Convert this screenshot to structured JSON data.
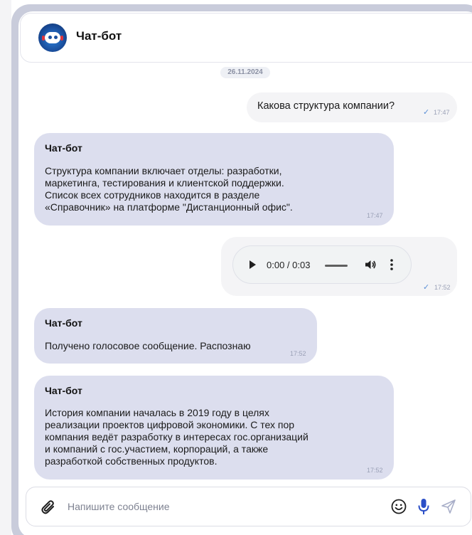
{
  "header": {
    "title": "Чат-бот",
    "avatar_icon": "robot-avatar-icon"
  },
  "date_separator": "26.11.2024",
  "messages": [
    {
      "type": "outgoing",
      "text": "Какова структура компании?",
      "time": "17:47",
      "status_icon": "check-icon"
    },
    {
      "type": "incoming",
      "sender": "Чат-бот",
      "lines": [
        "Структура компании включает отделы: разработки,",
        "маркетинга, тестирования и клиентской поддержки.",
        "Список всех сотрудников находится в разделе",
        "«Справочник» на платформе \"Дистанционный офис\"."
      ],
      "time": "17:47"
    },
    {
      "type": "outgoing-audio",
      "audio_time": "0:00 / 0:03",
      "time": "17:52",
      "status_icon": "check-icon"
    },
    {
      "type": "incoming",
      "sender": "Чат-бот",
      "lines": [
        "Получено голосовое сообщение. Распознаю"
      ],
      "time": "17:52"
    },
    {
      "type": "incoming",
      "sender": "Чат-бот",
      "lines": [
        "История компании началась в 2019 году в целях",
        "реализации проектов цифровой экономики. С тех пор",
        "компания ведёт разработку в интересах гос.организаций",
        "и компаний с гос.участием, корпораций, а также",
        "разработкой собственных продуктов."
      ],
      "time": "17:52"
    }
  ],
  "composer": {
    "placeholder": "Напишите сообщение",
    "value": "",
    "icons": [
      "paperclip-icon",
      "emoji-icon",
      "microphone-icon",
      "send-icon"
    ]
  },
  "colors": {
    "frame": "#c9ccdb",
    "incoming_bubble": "#dcdeee",
    "outgoing_bubble": "#f4f4f6",
    "accent": "#2b4fc7",
    "time_text": "#9aa0b6"
  }
}
